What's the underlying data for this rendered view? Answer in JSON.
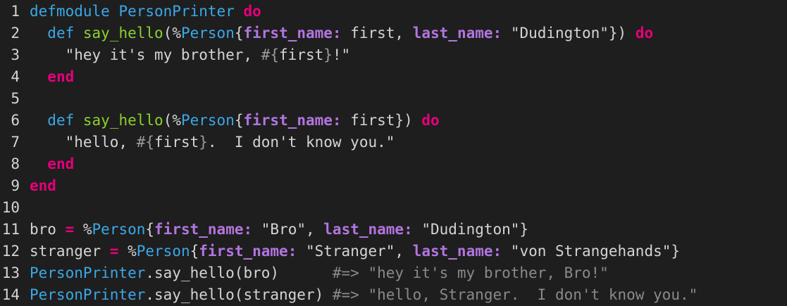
{
  "colors": {
    "background": "#1e1e1e",
    "default": "#d4d4d4",
    "keyword": "#e6007a",
    "module": "#3aa8e8",
    "function": "#8bd12f",
    "key": "#b275e0",
    "string": "#d4d4d4",
    "comment": "#8a8a8a",
    "interp": "#9a9a9a"
  },
  "lines": [
    {
      "n": "1",
      "tokens": [
        {
          "t": "defmodule",
          "c": "module"
        },
        {
          "t": " ",
          "c": "default"
        },
        {
          "t": "PersonPrinter",
          "c": "module"
        },
        {
          "t": " ",
          "c": "default"
        },
        {
          "t": "do",
          "c": "keyword"
        }
      ]
    },
    {
      "n": "2",
      "tokens": [
        {
          "t": "  ",
          "c": "default"
        },
        {
          "t": "def",
          "c": "module"
        },
        {
          "t": " ",
          "c": "default"
        },
        {
          "t": "say_hello",
          "c": "function"
        },
        {
          "t": "(%",
          "c": "default"
        },
        {
          "t": "Person",
          "c": "module"
        },
        {
          "t": "{",
          "c": "default"
        },
        {
          "t": "first_name:",
          "c": "key"
        },
        {
          "t": " first, ",
          "c": "default"
        },
        {
          "t": "last_name:",
          "c": "key"
        },
        {
          "t": " \"Dudington\"}) ",
          "c": "default"
        },
        {
          "t": "do",
          "c": "keyword"
        }
      ]
    },
    {
      "n": "3",
      "tokens": [
        {
          "t": "    \"hey it's my brother, ",
          "c": "default"
        },
        {
          "t": "#{",
          "c": "interp"
        },
        {
          "t": "first",
          "c": "default"
        },
        {
          "t": "}",
          "c": "interp"
        },
        {
          "t": "!\"",
          "c": "default"
        }
      ]
    },
    {
      "n": "4",
      "tokens": [
        {
          "t": "  ",
          "c": "default"
        },
        {
          "t": "end",
          "c": "keyword"
        }
      ]
    },
    {
      "n": "5",
      "tokens": []
    },
    {
      "n": "6",
      "tokens": [
        {
          "t": "  ",
          "c": "default"
        },
        {
          "t": "def",
          "c": "module"
        },
        {
          "t": " ",
          "c": "default"
        },
        {
          "t": "say_hello",
          "c": "function"
        },
        {
          "t": "(%",
          "c": "default"
        },
        {
          "t": "Person",
          "c": "module"
        },
        {
          "t": "{",
          "c": "default"
        },
        {
          "t": "first_name:",
          "c": "key"
        },
        {
          "t": " first}) ",
          "c": "default"
        },
        {
          "t": "do",
          "c": "keyword"
        }
      ]
    },
    {
      "n": "7",
      "tokens": [
        {
          "t": "    \"hello, ",
          "c": "default"
        },
        {
          "t": "#{",
          "c": "interp"
        },
        {
          "t": "first",
          "c": "default"
        },
        {
          "t": "}",
          "c": "interp"
        },
        {
          "t": ".  I don't know you.\"",
          "c": "default"
        }
      ]
    },
    {
      "n": "8",
      "tokens": [
        {
          "t": "  ",
          "c": "default"
        },
        {
          "t": "end",
          "c": "keyword"
        }
      ]
    },
    {
      "n": "9",
      "tokens": [
        {
          "t": "end",
          "c": "keyword"
        }
      ]
    },
    {
      "n": "10",
      "tokens": []
    },
    {
      "n": "11",
      "tokens": [
        {
          "t": "bro ",
          "c": "default"
        },
        {
          "t": "=",
          "c": "keyword"
        },
        {
          "t": " %",
          "c": "default"
        },
        {
          "t": "Person",
          "c": "module"
        },
        {
          "t": "{",
          "c": "default"
        },
        {
          "t": "first_name:",
          "c": "key"
        },
        {
          "t": " \"Bro\", ",
          "c": "default"
        },
        {
          "t": "last_name:",
          "c": "key"
        },
        {
          "t": " \"Dudington\"}",
          "c": "default"
        }
      ]
    },
    {
      "n": "12",
      "tokens": [
        {
          "t": "stranger ",
          "c": "default"
        },
        {
          "t": "=",
          "c": "keyword"
        },
        {
          "t": " %",
          "c": "default"
        },
        {
          "t": "Person",
          "c": "module"
        },
        {
          "t": "{",
          "c": "default"
        },
        {
          "t": "first_name:",
          "c": "key"
        },
        {
          "t": " \"Stranger\", ",
          "c": "default"
        },
        {
          "t": "last_name:",
          "c": "key"
        },
        {
          "t": " \"von Strangehands\"}",
          "c": "default"
        }
      ]
    },
    {
      "n": "13",
      "tokens": [
        {
          "t": "PersonPrinter",
          "c": "module"
        },
        {
          "t": ".say_hello(bro)      ",
          "c": "default"
        },
        {
          "t": "#=> \"hey it's my brother, Bro!\"",
          "c": "comment"
        }
      ]
    },
    {
      "n": "14",
      "tokens": [
        {
          "t": "PersonPrinter",
          "c": "module"
        },
        {
          "t": ".say_hello(stranger) ",
          "c": "default"
        },
        {
          "t": "#=> \"hello, Stranger.  I don't know you.\"",
          "c": "comment"
        }
      ]
    }
  ]
}
